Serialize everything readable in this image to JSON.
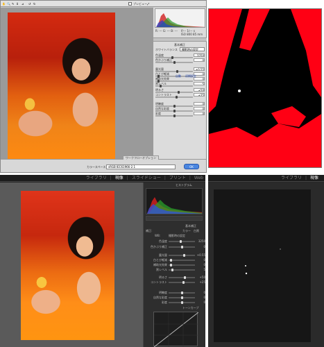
{
  "acr": {
    "toolbar": {
      "preview_label": "プレビュー"
    },
    "histogram_readout": {
      "rgb_values": "R: --- G: --- B: ---",
      "exif_1": "f/--- 1/--- s",
      "exif_2": "ISO 800  85 mm"
    },
    "panel_header": "基本補正",
    "white_balance": {
      "label": "ホワイトバランス",
      "value": "撮影時の設定"
    },
    "sliders": [
      {
        "label": "色温度",
        "value": "3250",
        "fill": 0.45
      },
      {
        "label": "色かぶり補正",
        "value": "0",
        "fill": 0.5
      },
      {
        "label": "露光量",
        "value": "+0.55",
        "fill": 0.58
      },
      {
        "label": "白とび軽減",
        "value": "0",
        "fill": 0.05
      },
      {
        "label": "補助光効果",
        "value": "0",
        "fill": 0.05
      },
      {
        "label": "黒レベル",
        "value": "5",
        "fill": 0.12
      },
      {
        "label": "明るさ",
        "value": "+50",
        "fill": 0.62
      },
      {
        "label": "コントラスト",
        "value": "+25",
        "fill": 0.56
      },
      {
        "label": "明瞭度",
        "value": "0",
        "fill": 0.5
      },
      {
        "label": "自然な彩度",
        "value": "0",
        "fill": 0.5
      },
      {
        "label": "彩度",
        "value": "0",
        "fill": 0.5
      }
    ],
    "link_auto": "自動",
    "link_default": "初期設定",
    "footer_tab": "ワークフローオプション",
    "colorspace_label": "カラースペース",
    "colorspace_value": "sRGB IEC61966-2.1",
    "ok_label": "OK"
  },
  "lr": {
    "tabs": [
      "ライブラリ",
      "現像",
      "スライドショー",
      "プリント",
      "Web"
    ],
    "tabs_right": [
      "ライブラリ",
      "現像"
    ],
    "histogram_header": "ヒストグラム",
    "basic_header": "基本補正",
    "treatment_label": "補正:",
    "treatment_color": "カラー",
    "treatment_bw": "白黒",
    "wb_label": "WB:",
    "wb_value": "撮影時の設定",
    "auto_label": "自動補正",
    "sliders": [
      {
        "label": "色温度",
        "value": "3250",
        "fill": 0.45
      },
      {
        "label": "色かぶり補正",
        "value": "0",
        "fill": 0.5
      },
      {
        "label": "露光量",
        "value": "+0.55",
        "fill": 0.58
      },
      {
        "label": "白とび軽減",
        "value": "0",
        "fill": 0.05
      },
      {
        "label": "補助光効果",
        "value": "0",
        "fill": 0.05
      },
      {
        "label": "黒レベル",
        "value": "5",
        "fill": 0.12
      },
      {
        "label": "明るさ",
        "value": "+50",
        "fill": 0.62
      },
      {
        "label": "コントラスト",
        "value": "+25",
        "fill": 0.56
      },
      {
        "label": "明瞭度",
        "value": "0",
        "fill": 0.5
      },
      {
        "label": "自然な彩度",
        "value": "0",
        "fill": 0.5
      },
      {
        "label": "彩度",
        "value": "0",
        "fill": 0.5
      }
    ],
    "tone_curve_header": "トーンカーブ"
  },
  "colors": {
    "clip_red": "#ff0014",
    "photo_orange": "#f07a10",
    "lr_dark": "#1e1e1e"
  }
}
